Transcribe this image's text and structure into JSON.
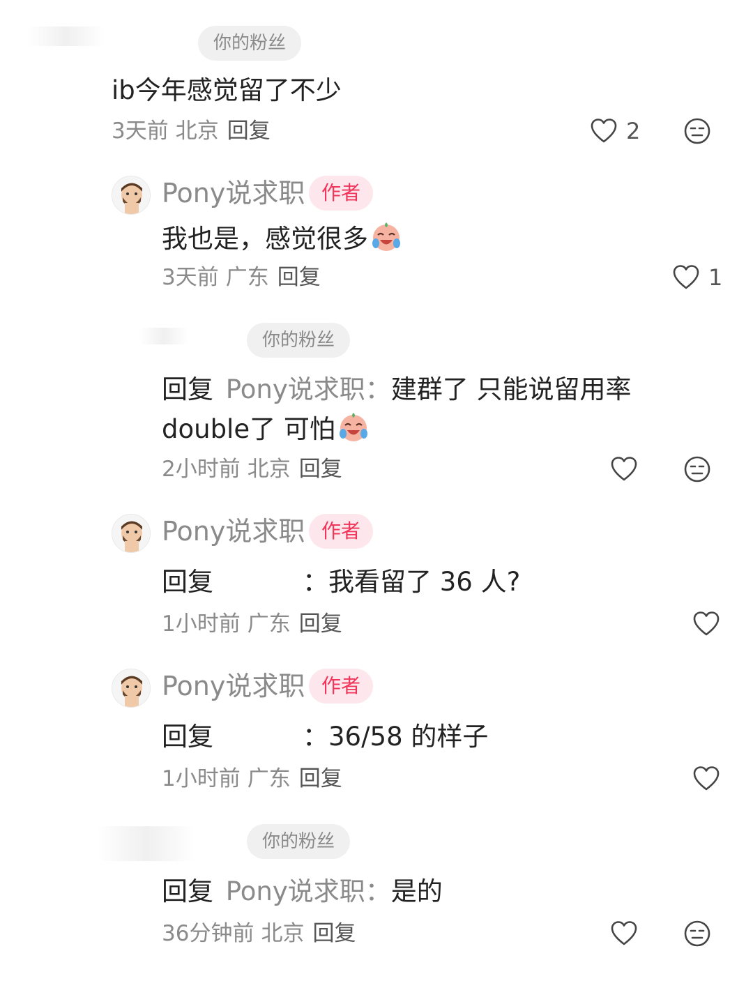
{
  "comments": [
    {
      "badge": "你的粉丝",
      "text": "ib今年感觉留了不少",
      "time": "3天前",
      "location": "北京",
      "reply_label": "回复",
      "likes": "2"
    },
    {
      "author": "Pony说求职",
      "author_badge": "作者",
      "text": "我也是，感觉很多",
      "time": "3天前",
      "location": "广东",
      "reply_label": "回复",
      "likes": "1"
    },
    {
      "badge": "你的粉丝",
      "reply_prefix": "回复",
      "reply_target": "Pony说求职",
      "colon": "：",
      "text_line1": "建群了 只能说留用率",
      "text_line2": "double了 可怕",
      "time": "2小时前",
      "location": "北京",
      "reply_label": "回复"
    },
    {
      "author": "Pony说求职",
      "author_badge": "作者",
      "reply_prefix": "回复",
      "colon": "：",
      "text": "我看留了 36 人?",
      "time": "1小时前",
      "location": "广东",
      "reply_label": "回复"
    },
    {
      "author": "Pony说求职",
      "author_badge": "作者",
      "reply_prefix": "回复",
      "colon": "：",
      "text": "36/58 的样子",
      "time": "1小时前",
      "location": "广东",
      "reply_label": "回复"
    },
    {
      "badge": "你的粉丝",
      "reply_prefix": "回复",
      "reply_target": "Pony说求职",
      "colon": "：",
      "text": "是的",
      "time": "36分钟前",
      "location": "北京",
      "reply_label": "回复"
    }
  ],
  "icons": {
    "like": "heart-outline-icon",
    "dislike": "neutral-face-icon",
    "emoji": "crying-laughing-emoji"
  },
  "colors": {
    "author_badge_text": "#f0345a",
    "author_badge_bg": "#fde7ec",
    "fan_badge_bg": "#f0f0f0",
    "meta_text": "#8a8a8a",
    "main_text": "#222222"
  }
}
